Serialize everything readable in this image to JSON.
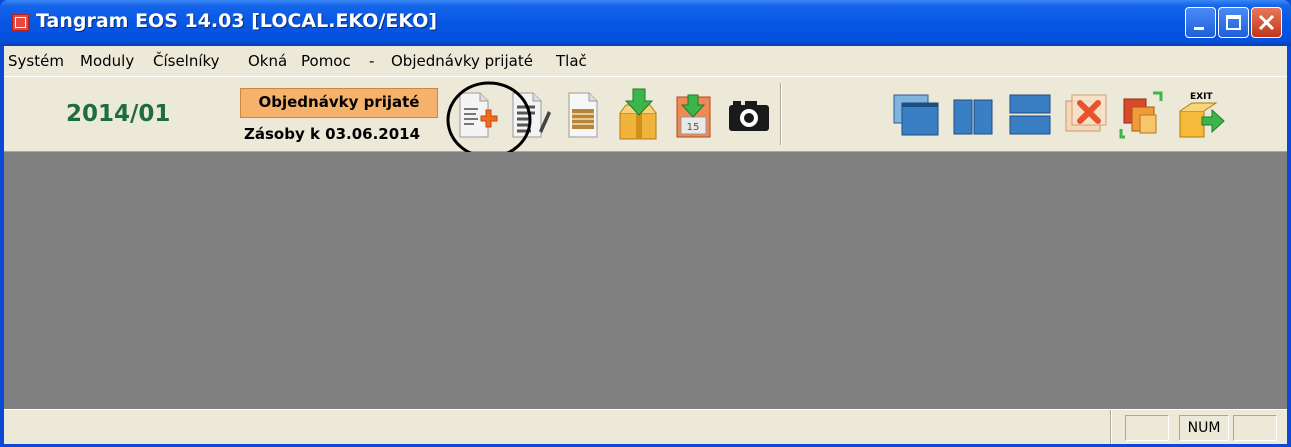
{
  "window": {
    "title": "Tangram EOS 14.03 [LOCAL.EKO/EKO]"
  },
  "menu": {
    "items": [
      "Systém",
      "Moduly",
      "Číselníky",
      "Okná",
      "Pomoc",
      "-",
      "Objednávky prijaté",
      "Tlač"
    ]
  },
  "toolbar": {
    "period": "2014/01",
    "module_label": "Objednávky prijaté",
    "module_subtitle": "Zásoby k 03.06.2014",
    "buttons": [
      {
        "icon": "new-document-icon"
      },
      {
        "icon": "edit-document-icon"
      },
      {
        "icon": "list-document-icon"
      },
      {
        "icon": "import-package-icon"
      },
      {
        "icon": "calendar-download-icon",
        "day": "15"
      },
      {
        "icon": "camera-icon"
      },
      {
        "icon": "cascade-windows-icon"
      },
      {
        "icon": "tile-vertical-icon"
      },
      {
        "icon": "tile-horizontal-icon"
      },
      {
        "icon": "close-windows-icon"
      },
      {
        "icon": "arrange-windows-icon"
      },
      {
        "icon": "exit-icon",
        "label": "EXIT"
      }
    ]
  },
  "statusbar": {
    "num_label": "NUM"
  },
  "colors": {
    "title_bar": "#0656e4",
    "module_button": "#f6b26b",
    "period_text": "#1e6b46",
    "workspace": "#808080"
  }
}
